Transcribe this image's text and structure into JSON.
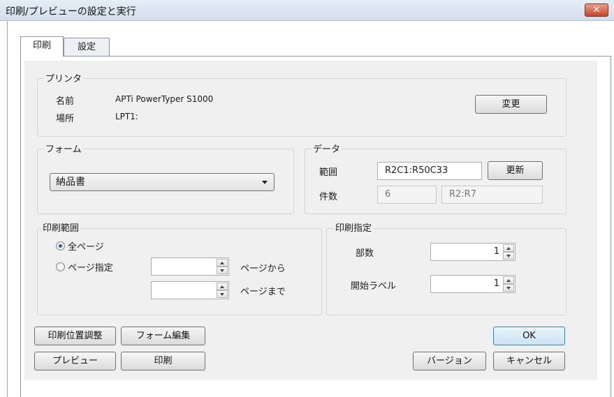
{
  "window": {
    "title": "印刷/プレビューの設定と実行",
    "close_glyph": "✕"
  },
  "tabs": [
    {
      "label": "印刷",
      "active": true
    },
    {
      "label": "設定",
      "active": false
    }
  ],
  "printer": {
    "group_label": "プリンタ",
    "name_label": "名前",
    "name_value": "APTi PowerTyper S1000",
    "location_label": "場所",
    "location_value": "LPT1:",
    "change_button": "変更"
  },
  "form": {
    "group_label": "フォーム",
    "selected": "納品書"
  },
  "data": {
    "group_label": "データ",
    "range_label": "範囲",
    "range_value": "R2C1:R50C33",
    "update_button": "更新",
    "count_label": "件数",
    "count_value": "6",
    "count_range": "R2:R7"
  },
  "print_range": {
    "group_label": "印刷範囲",
    "all_pages": "全ページ",
    "page_spec": "ページ指定",
    "from_suffix": "ページから",
    "to_suffix": "ページまで",
    "from_value": "",
    "to_value": "",
    "selected": "all_pages"
  },
  "print_spec": {
    "group_label": "印刷指定",
    "copies_label": "部数",
    "copies_value": "1",
    "start_label_label": "開始ラベル",
    "start_label_value": "1"
  },
  "buttons": {
    "position_adjust": "印刷位置調整",
    "form_edit": "フォーム編集",
    "ok": "OK",
    "preview": "プレビュー",
    "print": "印刷",
    "version": "バージョン",
    "cancel": "キャンセル"
  }
}
